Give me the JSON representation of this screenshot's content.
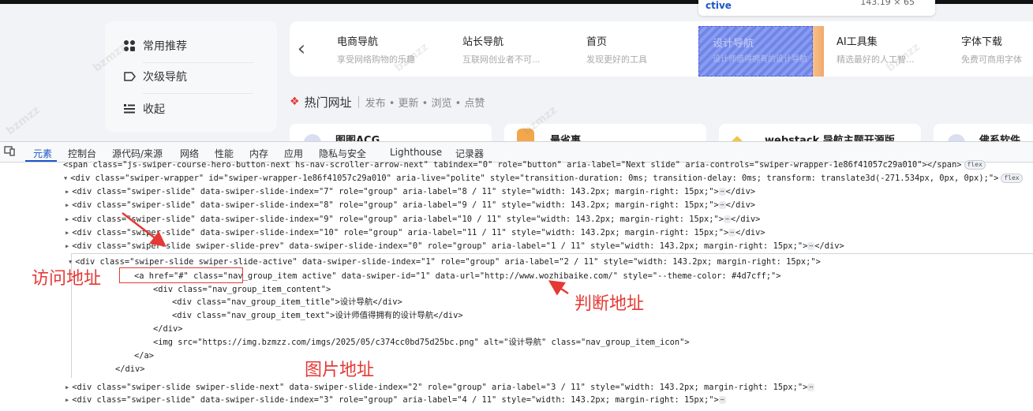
{
  "tooltip": {
    "label": "ctive",
    "size": "143.19 × 65"
  },
  "sidebar": {
    "items": [
      {
        "label": "常用推荐",
        "icon": "grid-icon"
      },
      {
        "label": "次级导航",
        "icon": "tag-icon"
      },
      {
        "label": "收起",
        "icon": "collapse-icon"
      }
    ]
  },
  "nav": {
    "items": [
      {
        "title": "电商导航",
        "text": "享受网络购物的乐趣"
      },
      {
        "title": "站长导航",
        "text": "互联网创业者不可..."
      },
      {
        "title": "首页",
        "text": "发现更好的工具"
      },
      {
        "title": "设计导航",
        "text": "设计师值得拥有的设计导航"
      },
      {
        "title": "AI工具集",
        "text": "精选最好的人工智..."
      },
      {
        "title": "字体下载",
        "text": "免费可商用字体"
      }
    ]
  },
  "hot": {
    "title": "热门网址",
    "meta": "发布 • 更新 • 浏览 • 点赞"
  },
  "cards": [
    {
      "title": "图图ACG"
    },
    {
      "title": "最省事"
    },
    {
      "title": "webstack 导航主题开源版"
    },
    {
      "title": "佛系软件"
    }
  ],
  "devtools": {
    "tabs": [
      "元素",
      "控制台",
      "源代码/来源",
      "网络",
      "性能",
      "内存",
      "应用",
      "隐私与安全",
      "Lighthouse",
      "记录器"
    ],
    "lines": [
      "<span class=\"js-swiper-course-hero-button-next hs-nav-scroller-arrow-next\" tabindex=\"0\" role=\"button\" aria-label=\"Next slide\" aria-controls=\"swiper-wrapper-1e86f41057c29a010\">",
      "<div class=\"swiper-wrapper\" id=\"swiper-wrapper-1e86f41057c29a010\" aria-live=\"polite\" style=\"transition-duration: 0ms; transition-delay: 0ms; transform: translate3d(-271.534px, 0px, 0px);\">",
      "<div class=\"swiper-slide\" data-swiper-slide-index=\"7\" role=\"group\" aria-label=\"8 / 11\" style=\"width: 143.2px; margin-right: 15px;\">",
      "<div class=\"swiper-slide\" data-swiper-slide-index=\"8\" role=\"group\" aria-label=\"9 / 11\" style=\"width: 143.2px; margin-right: 15px;\">",
      "<div class=\"swiper-slide\" data-swiper-slide-index=\"9\" role=\"group\" aria-label=\"10 / 11\" style=\"width: 143.2px; margin-right: 15px;\">",
      "<div class=\"swiper-slide\" data-swiper-slide-index=\"10\" role=\"group\" aria-label=\"11 / 11\" style=\"width: 143.2px; margin-right: 15px;\">",
      "<div class=\"swiper-slide swiper-slide-prev\" data-swiper-slide-index=\"0\" role=\"group\" aria-label=\"1 / 11\" style=\"width: 143.2px; margin-right: 15px;\">",
      "<div class=\"swiper-slide swiper-slide-active\" data-swiper-slide-index=\"1\" role=\"group\" aria-label=\"2 / 11\" style=\"width: 143.2px; margin-right: 15px;\">",
      "<a href=\"#\" class=\"nav_group_item active\" data-swiper-id=\"1\" data-url=\"http://www.wozhibaike.com/\" style=\"--theme-color: #4d7cff;\">",
      "<div class=\"nav_group_item_content\">",
      "<div class=\"nav_group_item_title\">设计导航</div>",
      "<div class=\"nav_group_item_text\">设计师值得拥有的设计导航</div>",
      "</div>",
      "<img src=\"https://img.bzmzz.com/imgs/2025/05/c374cc0bd75d25bc.png\" alt=\"设计导航\" class=\"nav_group_item_icon\">",
      "</a>",
      "</div>",
      "<div class=\"swiper-slide swiper-slide-next\" data-swiper-slide-index=\"2\" role=\"group\" aria-label=\"3 / 11\" style=\"width: 143.2px; margin-right: 15px;\">",
      "<div class=\"swiper-slide\" data-swiper-slide-index=\"3\" role=\"group\" aria-label=\"4 / 11\" style=\"width: 143.2px; margin-right: 15px;\">"
    ],
    "end_tags": [
      "</span>",
      "</div>",
      "</div>",
      "</div>",
      "</div>",
      "</div>"
    ],
    "badge_flex": "flex",
    "dots": "⋯"
  },
  "annotations": {
    "visit": "访问地址",
    "judge": "判断地址",
    "image": "图片地址"
  },
  "colors": {
    "annotation": "#e53935",
    "tab_active": "#1a56c8",
    "active_slide": "#6f86e8"
  },
  "watermark": "bzmzz"
}
